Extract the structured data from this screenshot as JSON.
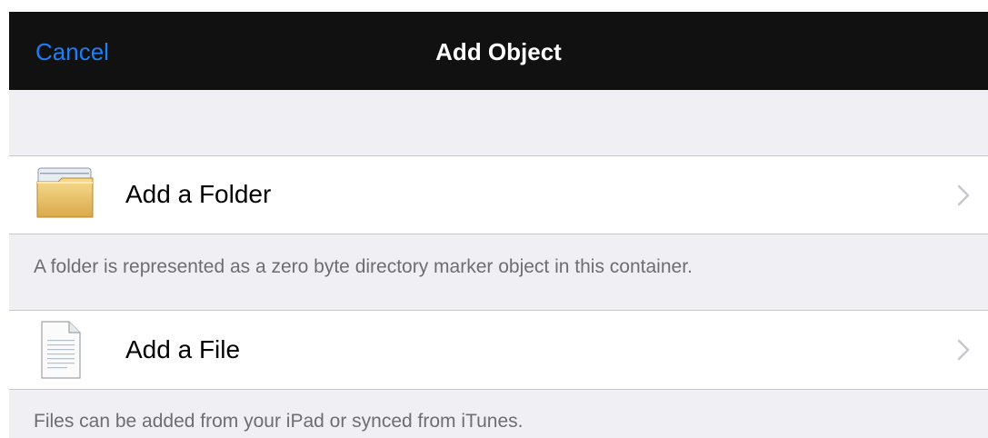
{
  "navbar": {
    "cancel_label": "Cancel",
    "title": "Add Object"
  },
  "rows": [
    {
      "label": "Add a Folder",
      "icon": "folder-icon",
      "footer": "A folder is represented as a zero byte directory marker object in this container."
    },
    {
      "label": "Add a File",
      "icon": "document-icon",
      "footer": "Files can be added from your iPad or synced from iTunes."
    }
  ],
  "colors": {
    "nav_background": "#111112",
    "accent": "#1e7ff5",
    "grouped_background": "#efeff4",
    "footer_text": "#6d6d72",
    "separator": "#c8c7cc"
  }
}
